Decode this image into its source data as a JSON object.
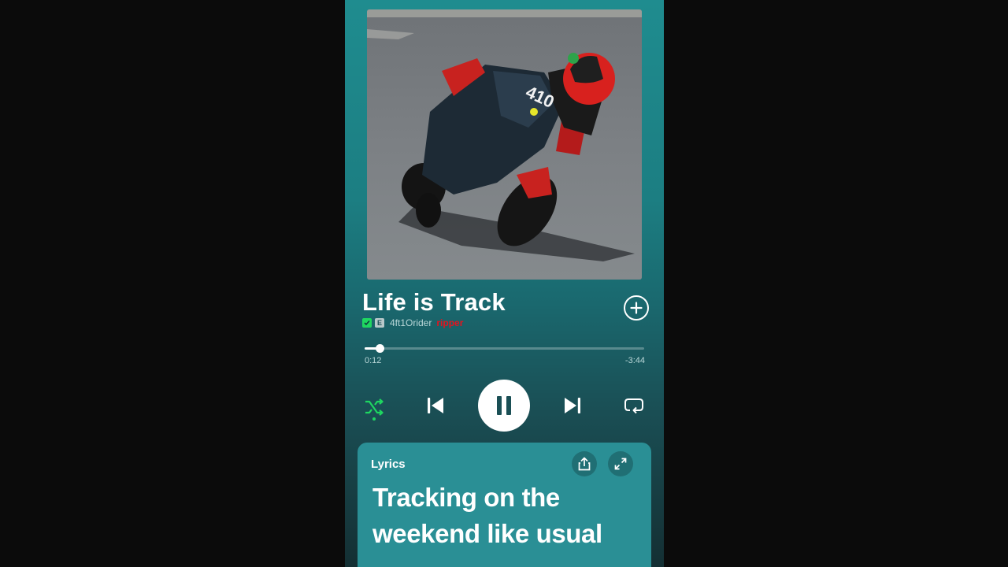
{
  "colors": {
    "accent": "#1ed760",
    "background_top": "#1f8c8f",
    "lyrics_card": "#2a8f95",
    "artist_tag": "#e3141f"
  },
  "album_art": {
    "icon": "album-cover-image",
    "racing_number": "410"
  },
  "track": {
    "title": "Life is Track",
    "artist": "4ft1Orider",
    "artist_tag": "ripper",
    "explicit_label": "E",
    "downloaded_icon": "download-check-icon"
  },
  "player": {
    "elapsed": "0:12",
    "remaining": "-3:44",
    "progress": 0.053,
    "shuffle_active": true,
    "icons": {
      "add": "plus-circle-icon",
      "shuffle": "shuffle-icon",
      "previous": "skip-previous-icon",
      "pause": "pause-icon",
      "next": "skip-next-icon",
      "repeat": "repeat-icon"
    }
  },
  "lyrics": {
    "heading": "Lyrics",
    "lines": [
      "Tracking on the",
      "weekend like usual"
    ],
    "share_icon": "share-icon",
    "expand_icon": "expand-icon"
  }
}
